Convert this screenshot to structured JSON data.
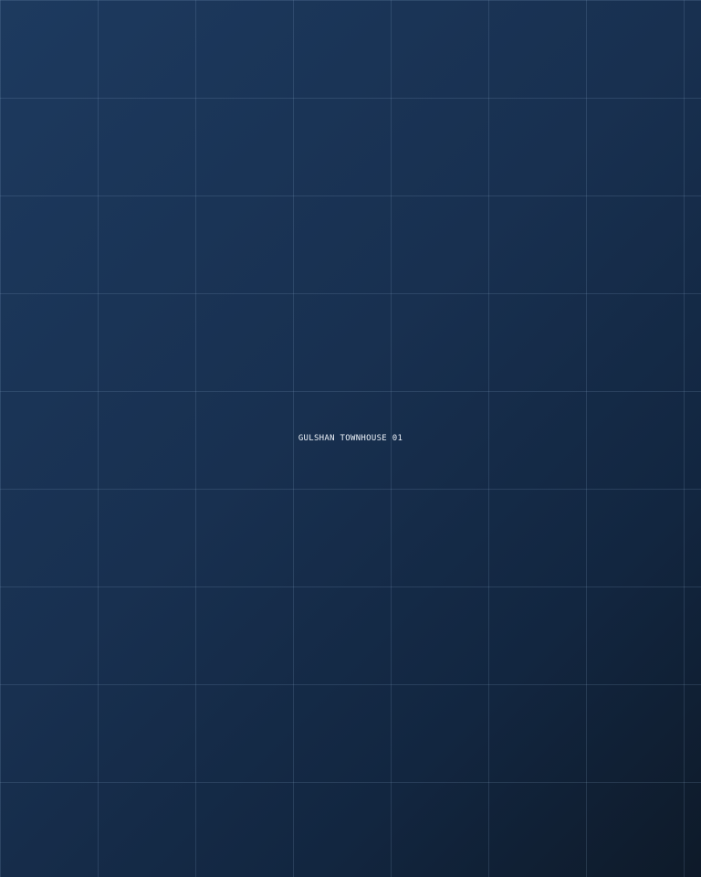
{
  "placeholder": {
    "label": "GULSHAN TOWNHOUSE 01"
  },
  "colors": {
    "background_top_left": "#1d3a5f",
    "background_bottom_right": "#0e1a29",
    "grid_line": "#8caacd",
    "label_text": "#eef3fa"
  }
}
